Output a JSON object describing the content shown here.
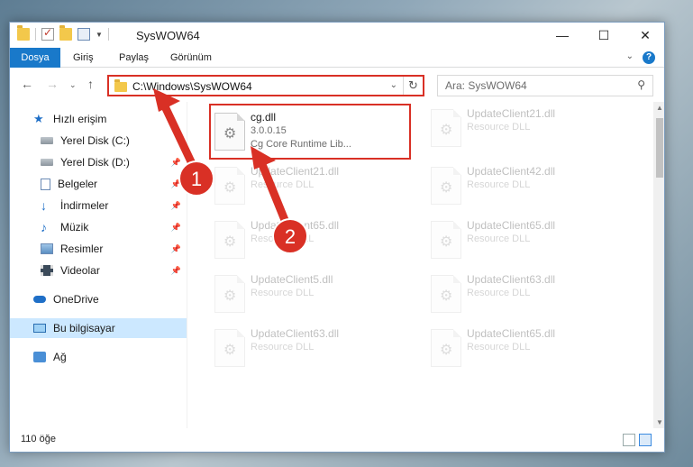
{
  "window": {
    "title": "SysWOW64"
  },
  "ribbon": {
    "tabs": [
      {
        "label": "Dosya"
      },
      {
        "label": "Giriş"
      },
      {
        "label": "Paylaş"
      },
      {
        "label": "Görünüm"
      }
    ]
  },
  "address": {
    "path": "C:\\Windows\\SysWOW64"
  },
  "search": {
    "placeholder": "Ara: SysWOW64"
  },
  "sidebar": {
    "items": [
      {
        "label": "Hızlı erişim",
        "icon": "star-icon"
      },
      {
        "label": "Yerel Disk (C:)",
        "icon": "drive-icon"
      },
      {
        "label": "Yerel Disk (D:)",
        "icon": "drive-icon"
      },
      {
        "label": "Belgeler",
        "icon": "document-icon"
      },
      {
        "label": "İndirmeler",
        "icon": "download-icon"
      },
      {
        "label": "Müzik",
        "icon": "music-icon"
      },
      {
        "label": "Resimler",
        "icon": "pictures-icon"
      },
      {
        "label": "Videolar",
        "icon": "videos-icon"
      },
      {
        "label": "OneDrive",
        "icon": "cloud-icon"
      },
      {
        "label": "Bu bilgisayar",
        "icon": "computer-icon"
      },
      {
        "label": "Ağ",
        "icon": "network-icon"
      }
    ]
  },
  "files": [
    {
      "name": "cg.dll",
      "line2": "3.0.0.15",
      "line3": "Cg Core Runtime Lib..."
    },
    {
      "name": "UpdateClient21.dll",
      "line2": "Resource DLL"
    },
    {
      "name": "UpdateClient21.dll",
      "line2": "Resource DLL"
    },
    {
      "name": "UpdateClient42.dll",
      "line2": "Resource DLL"
    },
    {
      "name": "UpdateClient65.dll",
      "line2": "Resource DLL"
    },
    {
      "name": "UpdateClient65.dll",
      "line2": "Resource DLL"
    },
    {
      "name": "UpdateClient5.dll",
      "line2": "Resource DLL"
    },
    {
      "name": "UpdateClient63.dll",
      "line2": "Resource DLL"
    },
    {
      "name": "UpdateClient63.dll",
      "line2": "Resource DLL"
    },
    {
      "name": "UpdateClient65.dll",
      "line2": "Resource DLL"
    }
  ],
  "status": {
    "count": "110 öğe"
  },
  "annotations": {
    "marker1": "1",
    "marker2": "2",
    "color": "#d93025"
  }
}
